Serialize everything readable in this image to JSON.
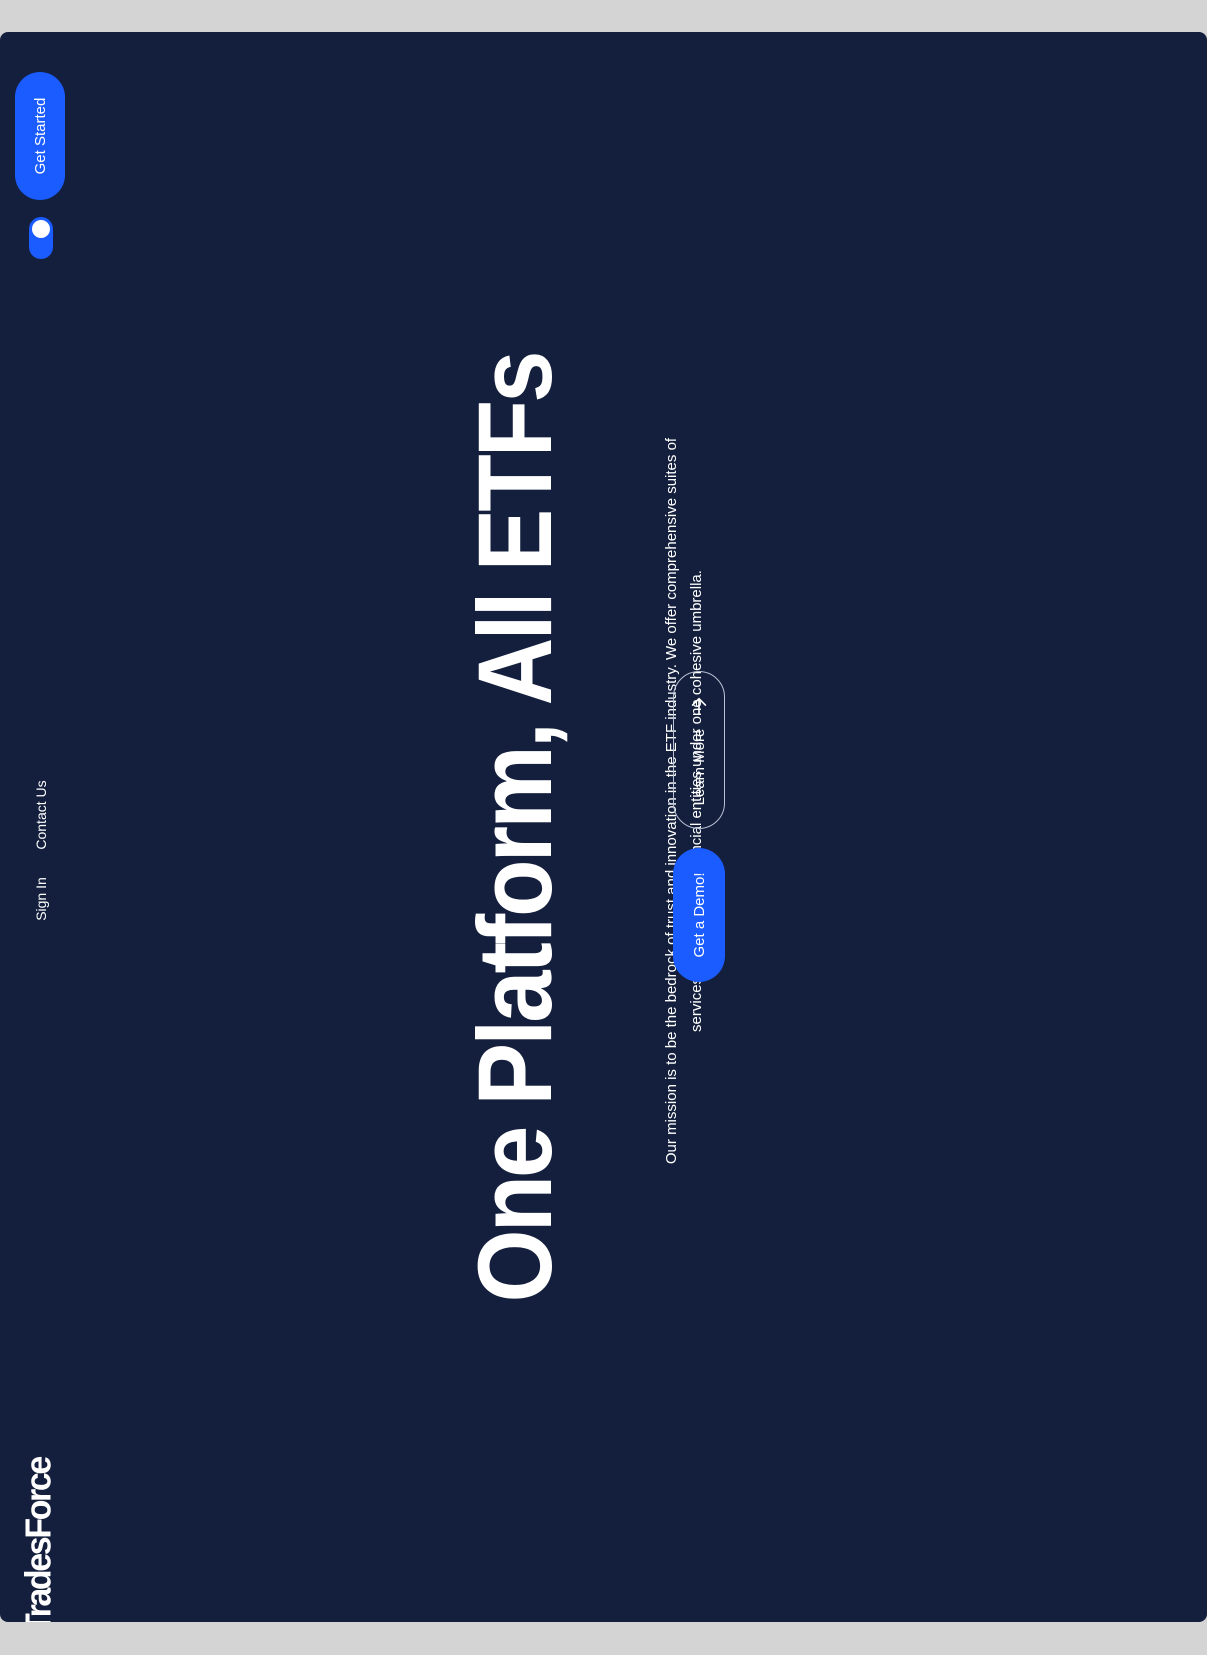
{
  "brand": {
    "logo_text": "TradesForce"
  },
  "nav": {
    "links": [
      {
        "label": "Sign In"
      },
      {
        "label": "Contact Us"
      }
    ],
    "get_started_label": "Get Started",
    "theme_toggle": {
      "state": "on"
    }
  },
  "hero": {
    "headline": "One Platform, All ETFs",
    "mission": "Our mission is to be the bedrock of trust and innovation in the ETF industry. We offer comprehensive suites of services that empower financial entities under one cohesive umbrella.",
    "primary_cta": "Get a Demo!",
    "secondary_cta": "Learn More",
    "secondary_cta_icon": "arrow-right-icon"
  },
  "colors": {
    "background": "#131f3c",
    "page_frame": "#d4d4d4",
    "accent": "#1a5cff",
    "text": "#ffffff"
  }
}
